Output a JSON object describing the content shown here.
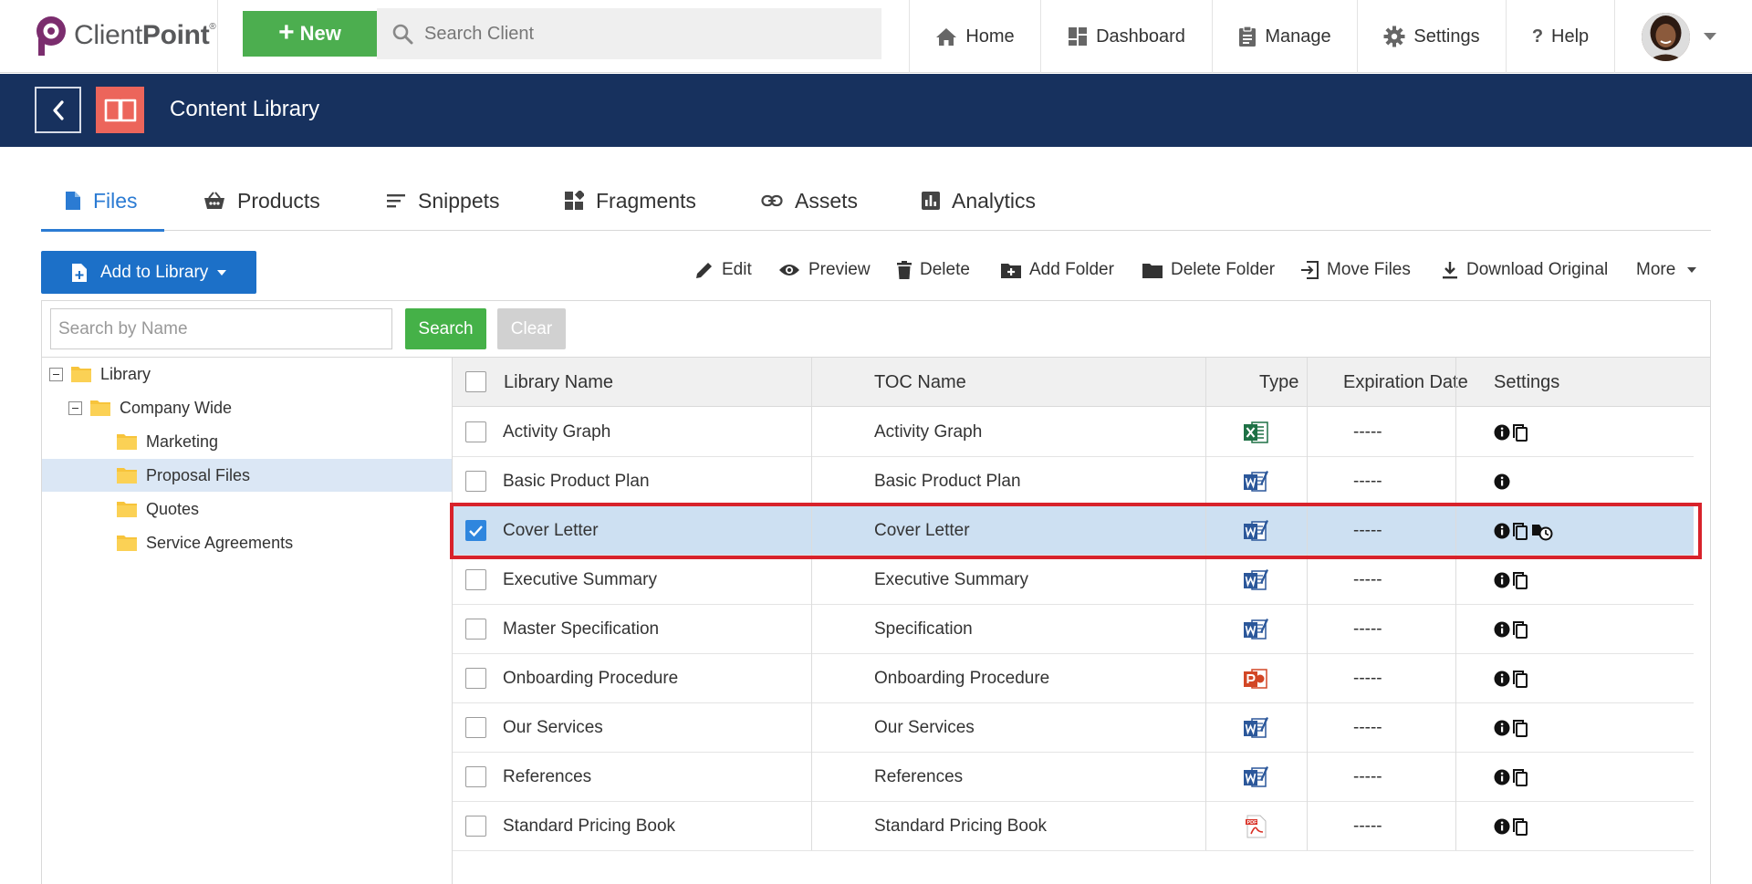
{
  "topbar": {
    "logo": {
      "text_light": "Client",
      "text_bold": "Point",
      "mark": "®"
    },
    "new_button": "New",
    "search_placeholder": "Search Client",
    "nav": [
      {
        "label": "Home",
        "icon": "home-icon"
      },
      {
        "label": "Dashboard",
        "icon": "dashboard-icon"
      },
      {
        "label": "Manage",
        "icon": "clipboard-icon"
      },
      {
        "label": "Settings",
        "icon": "gear-icon"
      },
      {
        "label": "Help",
        "icon": "question-icon"
      }
    ]
  },
  "header": {
    "title": "Content Library"
  },
  "tabs": [
    {
      "label": "Files",
      "icon": "file-icon",
      "active": true
    },
    {
      "label": "Products",
      "icon": "basket-icon",
      "active": false
    },
    {
      "label": "Snippets",
      "icon": "lines-icon",
      "active": false
    },
    {
      "label": "Fragments",
      "icon": "fragments-icon",
      "active": false
    },
    {
      "label": "Assets",
      "icon": "link-icon",
      "active": false
    },
    {
      "label": "Analytics",
      "icon": "analytics-icon",
      "active": false
    }
  ],
  "toolbar": {
    "add_to_library": "Add to Library",
    "actions": [
      {
        "label": "Edit",
        "icon": "pencil-icon"
      },
      {
        "label": "Preview",
        "icon": "eye-icon"
      },
      {
        "label": "Delete",
        "icon": "trash-icon"
      },
      {
        "label": "Add Folder",
        "icon": "folder-plus-icon"
      },
      {
        "label": "Delete Folder",
        "icon": "folder-icon"
      },
      {
        "label": "Move Files",
        "icon": "move-icon"
      },
      {
        "label": "Download Original",
        "icon": "download-icon"
      },
      {
        "label": "More",
        "icon": "chevron-down-icon"
      }
    ]
  },
  "filter": {
    "placeholder": "Search by Name",
    "search_button": "Search",
    "clear_button": "Clear"
  },
  "tree": [
    {
      "label": "Library",
      "level": 0,
      "expanded": true
    },
    {
      "label": "Company Wide",
      "level": 1,
      "expanded": true
    },
    {
      "label": "Marketing",
      "level": 2
    },
    {
      "label": "Proposal Files",
      "level": 2,
      "selected": true
    },
    {
      "label": "Quotes",
      "level": 2
    },
    {
      "label": "Service Agreements",
      "level": 2
    }
  ],
  "grid": {
    "columns": [
      "Library Name",
      "TOC Name",
      "Type",
      "Expiration Date",
      "Settings"
    ],
    "rows": [
      {
        "library_name": "Activity Graph",
        "toc_name": "Activity Graph",
        "type": "excel",
        "expiration": "-----",
        "settings": [
          "info",
          "copy"
        ],
        "checked": false
      },
      {
        "library_name": "Basic Product Plan",
        "toc_name": "Basic Product Plan",
        "type": "word",
        "expiration": "-----",
        "settings": [
          "info"
        ],
        "checked": false
      },
      {
        "library_name": "Cover Letter",
        "toc_name": "Cover Letter",
        "type": "word",
        "expiration": "-----",
        "settings": [
          "info",
          "copy",
          "clock"
        ],
        "checked": true
      },
      {
        "library_name": "Executive Summary",
        "toc_name": "Executive Summary",
        "type": "word",
        "expiration": "-----",
        "settings": [
          "info",
          "copy"
        ],
        "checked": false
      },
      {
        "library_name": "Master Specification",
        "toc_name": "Specification",
        "type": "word",
        "expiration": "-----",
        "settings": [
          "info",
          "copy"
        ],
        "checked": false
      },
      {
        "library_name": "Onboarding Procedure",
        "toc_name": "Onboarding Procedure",
        "type": "powerpoint",
        "expiration": "-----",
        "settings": [
          "info",
          "copy"
        ],
        "checked": false
      },
      {
        "library_name": "Our Services",
        "toc_name": "Our Services",
        "type": "word",
        "expiration": "-----",
        "settings": [
          "info",
          "copy"
        ],
        "checked": false
      },
      {
        "library_name": "References",
        "toc_name": "References",
        "type": "word",
        "expiration": "-----",
        "settings": [
          "info",
          "copy"
        ],
        "checked": false
      },
      {
        "library_name": "Standard Pricing Book",
        "toc_name": "Standard Pricing Book",
        "type": "pdf",
        "expiration": "-----",
        "settings": [
          "info",
          "copy"
        ],
        "checked": false
      }
    ]
  },
  "colors": {
    "brand_purple": "#7b2d6e",
    "new_green": "#4cae4f",
    "header_navy": "#17315e",
    "book_red": "#ec655b",
    "accent_blue": "#2b7bd3",
    "highlight_red": "#d8222b",
    "selected_row": "#cde0f2"
  }
}
